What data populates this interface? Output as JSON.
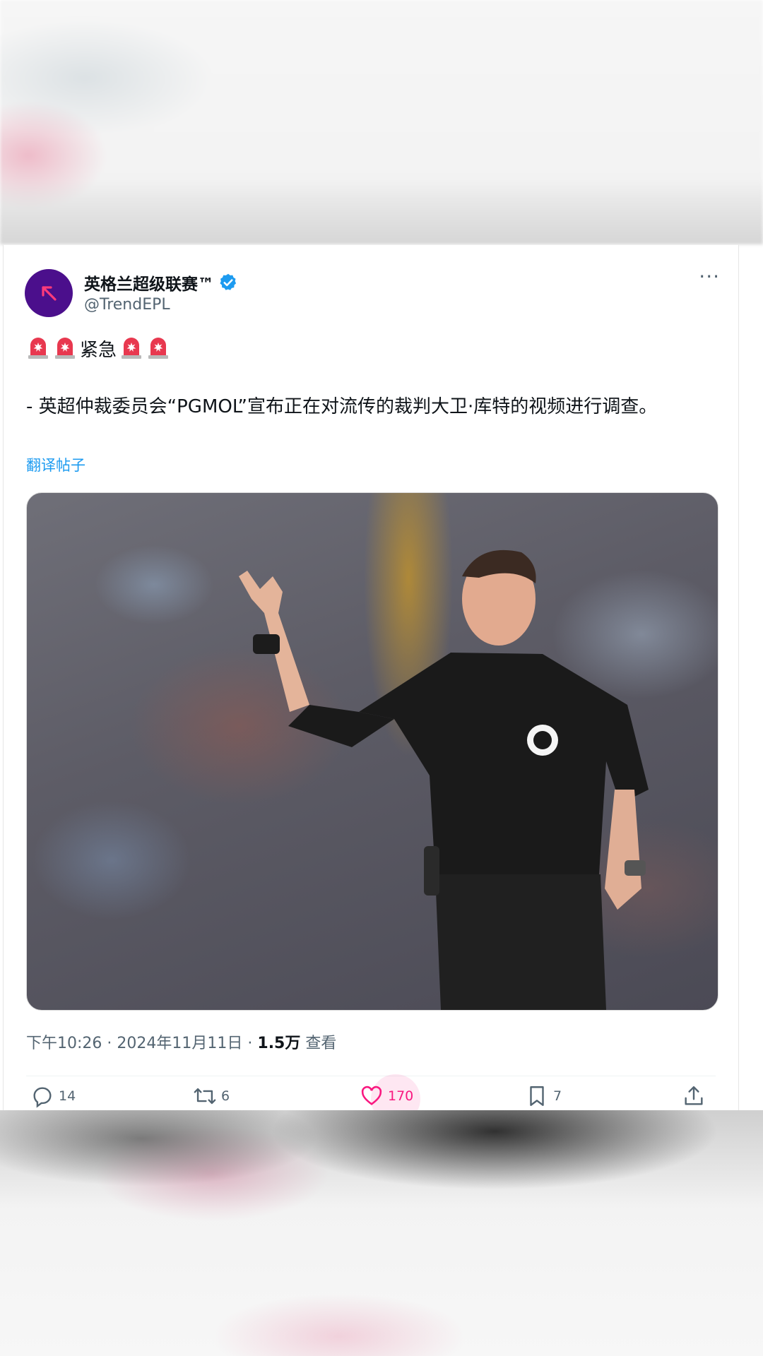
{
  "account": {
    "name": "英格兰超级联赛™",
    "handle": "@TrendEPL"
  },
  "post": {
    "alert_word": "紧急",
    "text": "- 英超仲裁委员会“PGMOL”宣布正在对流传的裁判大卫·库特的视频进行调查。",
    "translate_link": "翻译帖子",
    "time": "下午10:26",
    "date": "2024年11月11日",
    "views_count": "1.5万",
    "views_label": "查看",
    "separator": "·"
  },
  "actions": {
    "replies": "14",
    "reposts": "6",
    "likes": "170",
    "bookmarks": "7"
  },
  "colors": {
    "accent_blue": "#1d9bf0",
    "like_pink": "#f91880",
    "avatar_bg": "#4b0f8c"
  }
}
